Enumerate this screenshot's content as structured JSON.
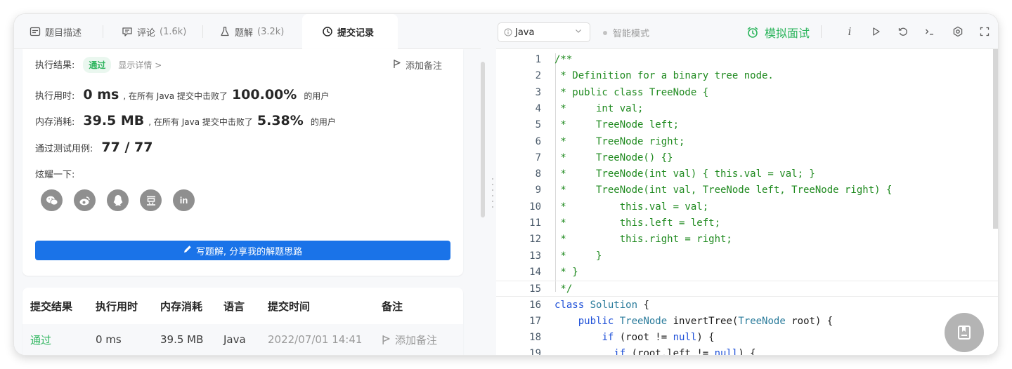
{
  "tabs": [
    {
      "label": "题目描述",
      "count": "",
      "icon": "description-icon"
    },
    {
      "label": "评论",
      "count": "(1.6k)",
      "icon": "comment-icon"
    },
    {
      "label": "题解",
      "count": "(3.2k)",
      "icon": "flask-icon"
    },
    {
      "label": "提交记录",
      "count": "",
      "icon": "clock-icon"
    }
  ],
  "result": {
    "status_label": "执行结果:",
    "status": "通过",
    "details_link": "显示详情 >",
    "add_note": "添加备注",
    "runtime_label": "执行用时:",
    "runtime_value": "0 ms",
    "runtime_text": ", 在所有 Java 提交中击败了",
    "runtime_pct": "100.00%",
    "runtime_suffix": "的用户",
    "memory_label": "内存消耗:",
    "memory_value": "39.5 MB",
    "memory_text": ", 在所有 Java 提交中击败了",
    "memory_pct": "5.38%",
    "memory_suffix": "的用户",
    "tests_label": "通过测试用例:",
    "tests_value": "77 / 77",
    "share_label": "炫耀一下:",
    "share_icons": [
      "wechat-icon",
      "weibo-icon",
      "qq-icon",
      "douban-icon",
      "linkedin-icon"
    ],
    "write_button": "写题解, 分享我的解题思路"
  },
  "table": {
    "headers": [
      "提交结果",
      "执行用时",
      "内存消耗",
      "语言",
      "提交时间",
      "备注"
    ],
    "rows": [
      {
        "status": "通过",
        "runtime": "0 ms",
        "memory": "39.5 MB",
        "lang": "Java",
        "time": "2022/07/01 14:41",
        "note": "添加备注"
      }
    ]
  },
  "toolbar": {
    "language": "Java",
    "mode": "智能模式",
    "mock_interview": "模拟面试",
    "tools": [
      "info-icon",
      "run-icon",
      "reset-icon",
      "console-icon",
      "settings-icon",
      "fullscreen-icon"
    ]
  },
  "editor": {
    "current_line": 15,
    "lines": [
      {
        "n": "1",
        "text": "/**",
        "comment": true
      },
      {
        "n": "2",
        "text": " * Definition for a binary tree node.",
        "comment": true
      },
      {
        "n": "3",
        "text": " * public class TreeNode {",
        "comment": true
      },
      {
        "n": "4",
        "text": " *     int val;",
        "comment": true
      },
      {
        "n": "5",
        "text": " *     TreeNode left;",
        "comment": true
      },
      {
        "n": "6",
        "text": " *     TreeNode right;",
        "comment": true
      },
      {
        "n": "7",
        "text": " *     TreeNode() {}",
        "comment": true
      },
      {
        "n": "8",
        "text": " *     TreeNode(int val) { this.val = val; }",
        "comment": true
      },
      {
        "n": "9",
        "text": " *     TreeNode(int val, TreeNode left, TreeNode right) {",
        "comment": true
      },
      {
        "n": "10",
        "text": " *         this.val = val;",
        "comment": true
      },
      {
        "n": "11",
        "text": " *         this.left = left;",
        "comment": true
      },
      {
        "n": "12",
        "text": " *         this.right = right;",
        "comment": true
      },
      {
        "n": "13",
        "text": " *     }",
        "comment": true
      },
      {
        "n": "14",
        "text": " * }",
        "comment": true
      },
      {
        "n": "15",
        "text": " */",
        "comment": true
      },
      {
        "n": "16",
        "text": "class Solution {",
        "comment": false
      },
      {
        "n": "17",
        "text": "    public TreeNode invertTree(TreeNode root) {",
        "comment": false
      },
      {
        "n": "18",
        "text": "        if (root != null) {",
        "comment": false
      },
      {
        "n": "19",
        "text": "          if (root.left != null) {",
        "comment": false
      }
    ]
  },
  "colors": {
    "accent": "#1a73e8",
    "success": "#2db55d",
    "comment": "#1f8a1f"
  }
}
